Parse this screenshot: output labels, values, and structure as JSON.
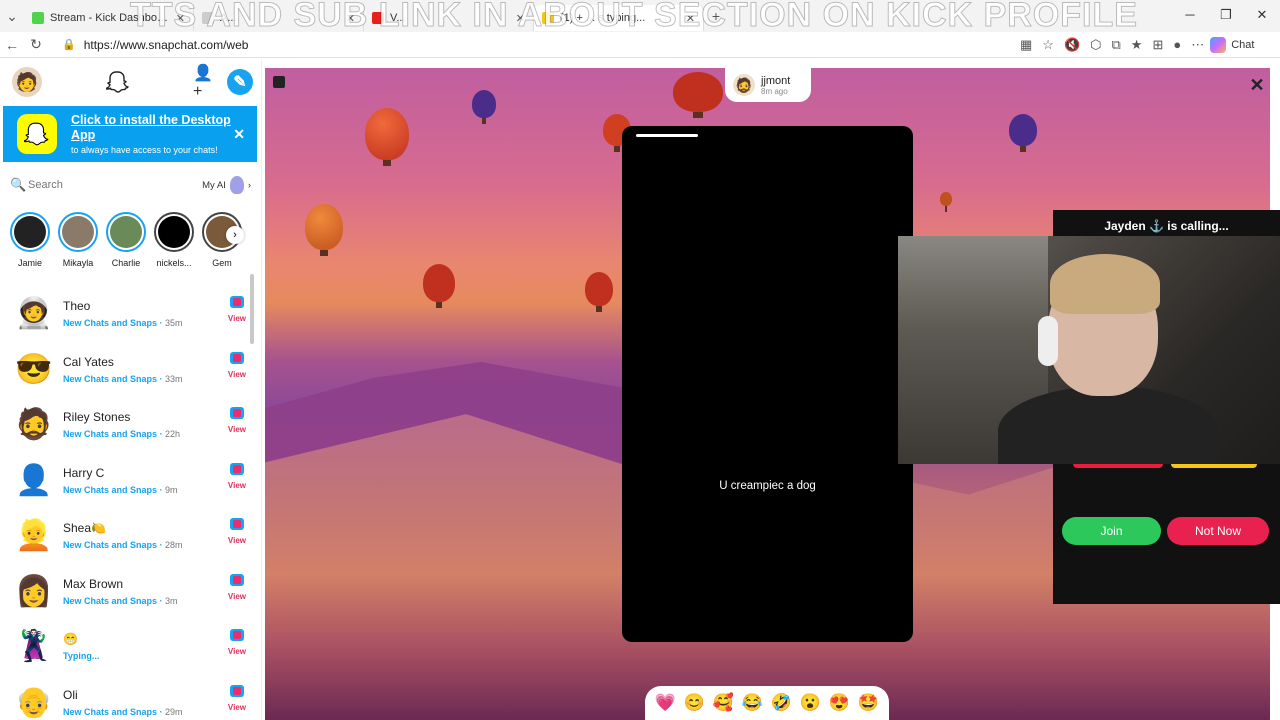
{
  "browser": {
    "tabs": [
      {
        "title": "Stream - Kick Dashboard",
        "color": "#52d14a"
      },
      {
        "title": "A...",
        "color": "#ccc"
      },
      {
        "title": "V...",
        "color": "#e62117"
      },
      {
        "title": "(1) + ... s typing...",
        "color": "#f5c518"
      }
    ],
    "overlay_text": "TTS AND SUB LINK IN ABOUT SECTION ON KICK PROFILE",
    "url": "https://www.snapchat.com/web",
    "chat_label": "Chat"
  },
  "sidebar": {
    "banner": {
      "title": "Click to install the Desktop App",
      "subtitle": "to always have access to your chats!"
    },
    "search": {
      "placeholder": "Search",
      "myai_label": "My AI"
    },
    "stories": [
      {
        "name": "Jamie",
        "color": "#222"
      },
      {
        "name": "Mikayla",
        "color": "#8a7a6a"
      },
      {
        "name": "Charlie",
        "color": "#6a8a5a"
      },
      {
        "name": "nickels...",
        "color": "#000"
      },
      {
        "name": "Gem",
        "color": "#7a5a3a"
      }
    ],
    "chats": [
      {
        "name": "Theo",
        "status": "New Chats and Snaps",
        "time": "35m",
        "avatar": "🧑‍🚀",
        "view": "View"
      },
      {
        "name": "Cal Yates",
        "status": "New Chats and Snaps",
        "time": "33m",
        "avatar": "😎",
        "view": "View"
      },
      {
        "name": "Riley Stones",
        "status": "New Chats and Snaps",
        "time": "22h",
        "avatar": "🧔",
        "view": "View"
      },
      {
        "name": "Harry C",
        "status": "New Chats and Snaps",
        "time": "9m",
        "avatar": "👤",
        "view": "View"
      },
      {
        "name": "Shea🍋",
        "status": "New Chats and Snaps",
        "time": "28m",
        "avatar": "👱",
        "view": "View"
      },
      {
        "name": "Max Brown",
        "status": "New Chats and Snaps",
        "time": "3m",
        "avatar": "👩",
        "view": "View"
      },
      {
        "name": "😁",
        "status": "Typing...",
        "time": "",
        "avatar": "🦹",
        "view": "View"
      },
      {
        "name": "Oli",
        "status": "New Chats and Snaps",
        "time": "29m",
        "avatar": "👴",
        "view": "View"
      }
    ]
  },
  "story": {
    "poster_name": "jjmont",
    "poster_time": "8m ago",
    "caption": "U creampiec a dog",
    "reactions": [
      "💗",
      "😊",
      "🥰",
      "😂",
      "🤣",
      "😮",
      "😍",
      "🤩"
    ]
  },
  "call": {
    "heading": "Jayden ⚓ is calling...",
    "join_label": "Join",
    "notnow_label": "Not Now"
  }
}
